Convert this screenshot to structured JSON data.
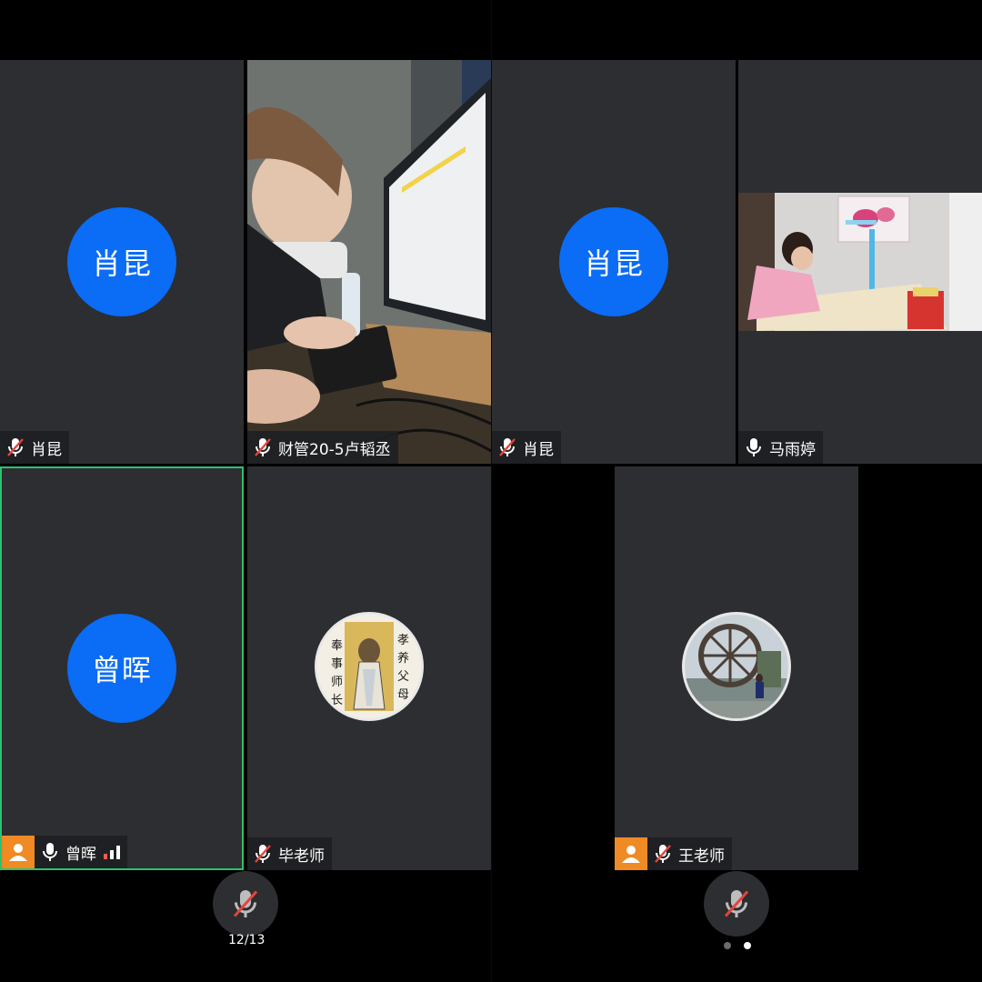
{
  "left_screen": {
    "tiles": [
      {
        "id": "xiaokun-1",
        "avatar_text": "肖昆",
        "name": "肖昆",
        "mic": "muted"
      },
      {
        "id": "lutaocheng",
        "name": "财管20-5卢韬丞",
        "mic": "muted",
        "video": "live"
      },
      {
        "id": "zenghui",
        "avatar_text": "曾晖",
        "name": "曾晖",
        "mic": "on",
        "host_icon": "user-icon",
        "signal": "3 bars",
        "active_speaker": true
      },
      {
        "id": "bilaoshi",
        "name": "毕老师",
        "mic": "muted",
        "avatar_image_text": [
          "孝",
          "养",
          "父",
          "母",
          "奉",
          "事",
          "师",
          "长"
        ]
      }
    ],
    "page_indicator": "12/13"
  },
  "right_screen": {
    "tiles": [
      {
        "id": "xiaokun-2",
        "avatar_text": "肖昆",
        "name": "肖昆",
        "mic": "muted"
      },
      {
        "id": "mayuting",
        "name": "马雨婷",
        "mic": "on",
        "video": "live"
      },
      {
        "id": "wanglaoshi",
        "name": "王老师",
        "mic": "muted",
        "host_icon": "user-icon"
      }
    ],
    "page_dots": 2,
    "active_dot": 2
  },
  "colors": {
    "tile_bg": "#2c2e32",
    "avatar_blue": "#0b6cf5",
    "host_orange": "#f08a24",
    "mute_red": "#e5443a",
    "active_border": "#2ec16e"
  }
}
